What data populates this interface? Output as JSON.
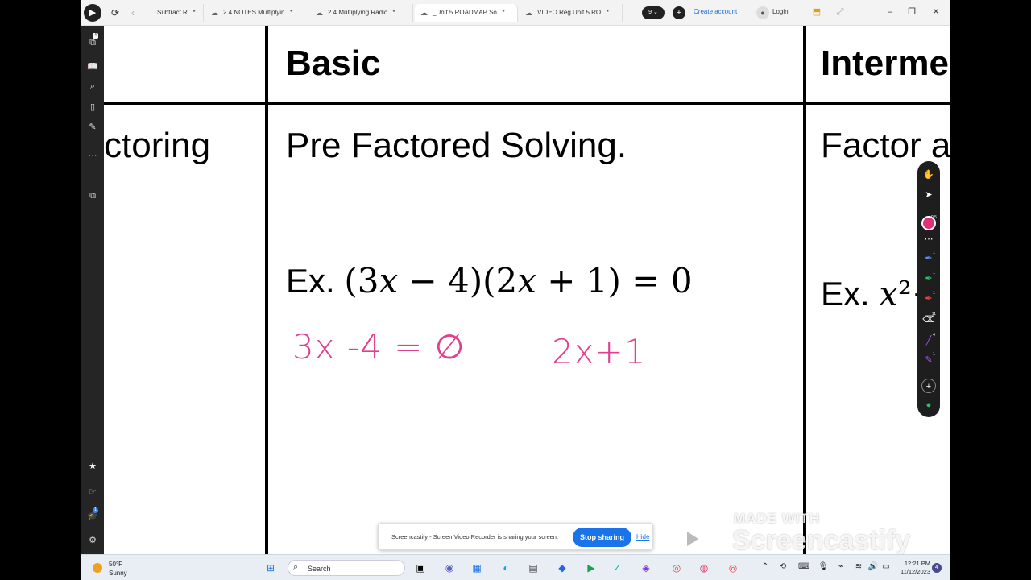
{
  "browser": {
    "tabs": [
      {
        "label": "Subtract R...*"
      },
      {
        "label": "2.4 NOTES Multiplyin...*"
      },
      {
        "label": "2.4 Multiplying Radic...*"
      },
      {
        "label": "_Unit 5 ROADMAP So...*"
      },
      {
        "label": "VIDEO Reg Unit 5 RO...*"
      }
    ],
    "active_tab": 3,
    "tab_count_pill": "9 ⌄",
    "create_account": "Create account",
    "login": "Login"
  },
  "left_rail": {
    "badges": [
      "4",
      "1"
    ]
  },
  "document": {
    "left_partial_text": "ctoring",
    "basic_header": "Basic",
    "basic_title": "Pre Factored Solving.",
    "basic_example_prefix": "Ex.",
    "basic_example_math": "(3𝑥 − 4)(2𝑥 + 1) = 0",
    "intermediate_header": "Interme",
    "intermediate_title": "Factor a",
    "intermediate_example_prefix": "Ex.",
    "intermediate_example_math": "𝑥²+",
    "handwriting_1": "3x -4 = ∅",
    "handwriting_2": "2x+1"
  },
  "pen_toolbar": {
    "badges": [
      "0.5",
      "1",
      "1",
      "1",
      "11",
      "4",
      "1"
    ]
  },
  "share_bar": {
    "message": "Screencastify - Screen Video Recorder is sharing your screen.",
    "stop_label": "Stop sharing",
    "hide_label": "Hide"
  },
  "watermark": {
    "made_with": "MADE WITH",
    "brand": "Screencastify"
  },
  "taskbar": {
    "weather_temp": "50°F",
    "weather_desc": "Sunny",
    "search_placeholder": "Search",
    "time": "12:21 PM",
    "date": "11/12/2023",
    "notification_count": "4"
  }
}
